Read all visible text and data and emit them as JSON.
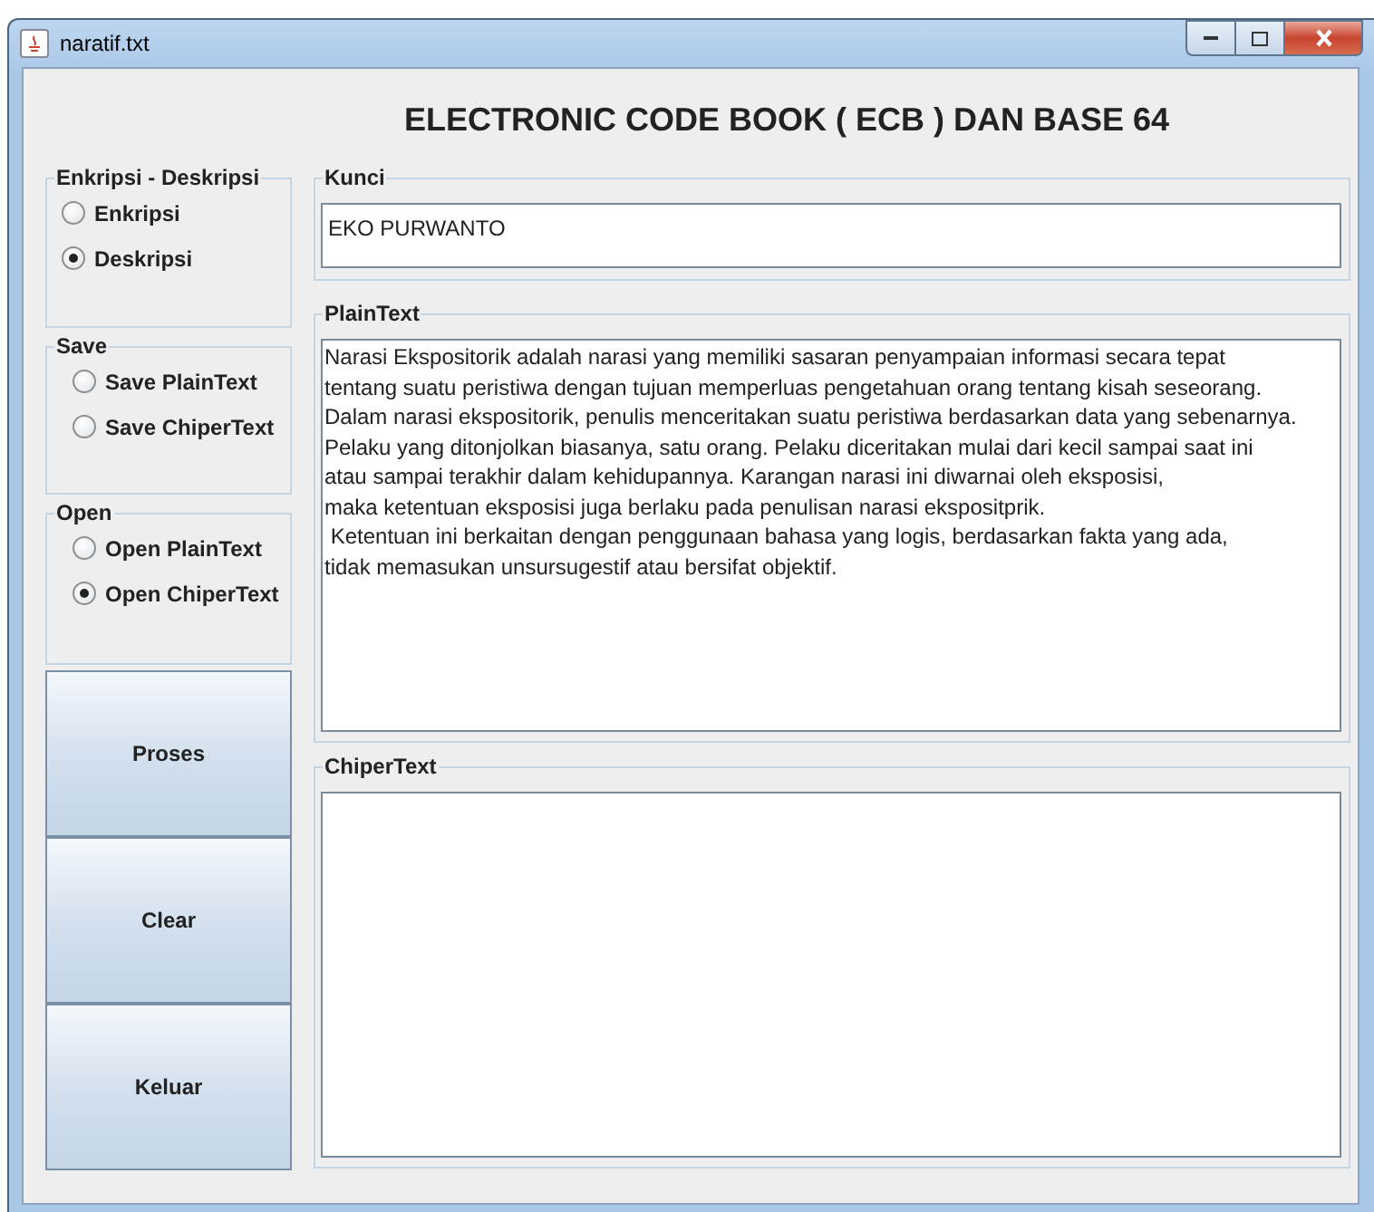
{
  "window": {
    "title": "naratif.txt"
  },
  "heading": "ELECTRONIC CODE BOOK ( ECB ) DAN BASE 64",
  "option_groups": [
    {
      "title": "Enkripsi - Deskripsi",
      "options": [
        {
          "label": "Enkripsi",
          "selected": false
        },
        {
          "label": "Deskripsi",
          "selected": true
        }
      ]
    },
    {
      "title": "Save",
      "options": [
        {
          "label": "Save PlainText",
          "selected": false
        },
        {
          "label": "Save ChiperText",
          "selected": false
        }
      ]
    },
    {
      "title": "Open",
      "options": [
        {
          "label": "Open PlainText",
          "selected": false
        },
        {
          "label": "Open ChiperText",
          "selected": true
        }
      ]
    }
  ],
  "buttons": [
    "Proses",
    "Clear",
    "Keluar"
  ],
  "key": {
    "title": "Kunci",
    "value": "EKO PURWANTO"
  },
  "plaintext": {
    "title": "PlainText",
    "value": "Narasi Ekspositorik adalah narasi yang memiliki sasaran penyampaian informasi secara tepat\ntentang suatu peristiwa dengan tujuan memperluas pengetahuan orang tentang kisah seseorang.\nDalam narasi ekspositorik, penulis menceritakan suatu peristiwa berdasarkan data yang sebenarnya.\nPelaku yang ditonjolkan biasanya, satu orang. Pelaku diceritakan mulai dari kecil sampai saat ini\natau sampai terakhir dalam kehidupannya. Karangan narasi ini diwarnai oleh eksposisi,\nmaka ketentuan eksposisi juga berlaku pada penulisan narasi ekspositprik.\n Ketentuan ini berkaitan dengan penggunaan bahasa yang logis, berdasarkan fakta yang ada,\ntidak memasukan unsursugestif atau bersifat objektif."
  },
  "ciphertext": {
    "title": "ChiperText"
  }
}
